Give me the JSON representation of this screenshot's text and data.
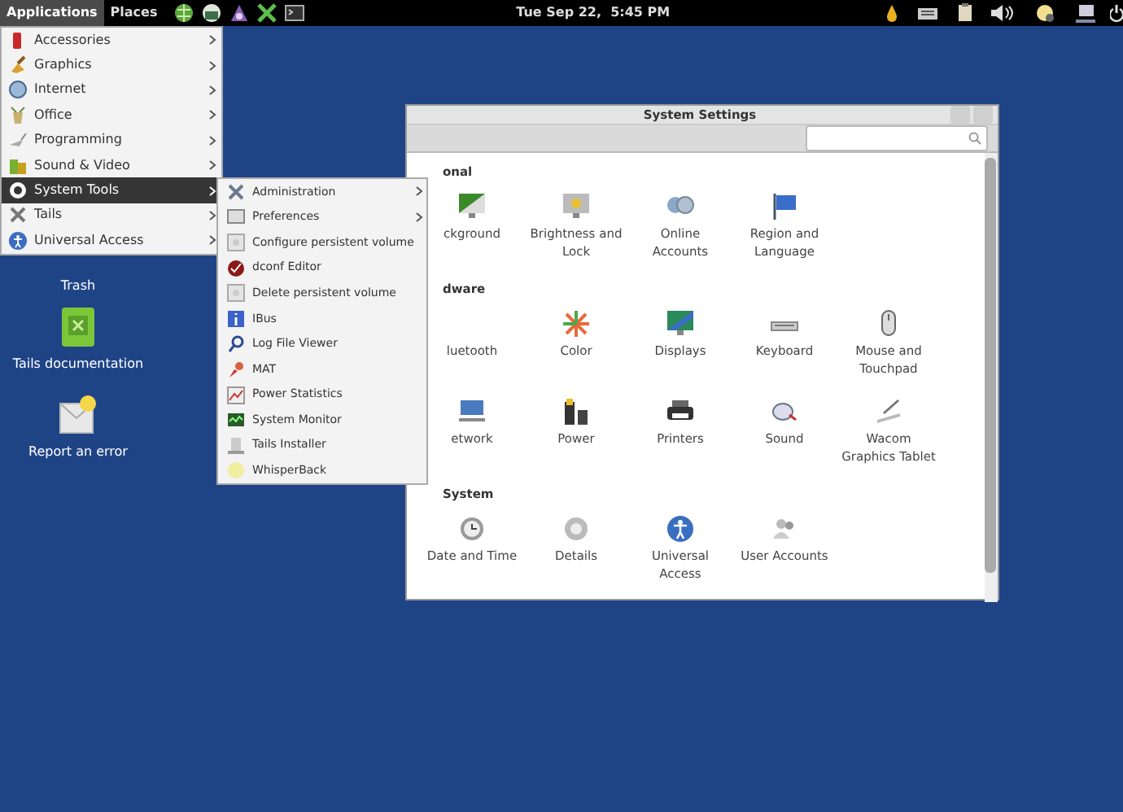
{
  "top_bar": {
    "menus": [
      {
        "label": "Applications",
        "selected": true
      },
      {
        "label": "Places",
        "selected": false
      }
    ],
    "clock": "Tue Sep 22,  5:45 PM"
  },
  "applications_menu": {
    "items": [
      {
        "label": "Accessories",
        "selected": false
      },
      {
        "label": "Graphics",
        "selected": false
      },
      {
        "label": "Internet",
        "selected": false
      },
      {
        "label": "Office",
        "selected": false
      },
      {
        "label": "Programming",
        "selected": false
      },
      {
        "label": "Sound & Video",
        "selected": false
      },
      {
        "label": "System Tools",
        "selected": true
      },
      {
        "label": "Tails",
        "selected": false
      },
      {
        "label": "Universal Access",
        "selected": false
      }
    ]
  },
  "system_tools_menu": {
    "items": [
      {
        "label": "Administration",
        "has_submenu": true
      },
      {
        "label": "Preferences",
        "has_submenu": true
      },
      {
        "label": "Configure persistent volume",
        "has_submenu": false
      },
      {
        "label": "dconf Editor",
        "has_submenu": false
      },
      {
        "label": "Delete persistent volume",
        "has_submenu": false
      },
      {
        "label": "IBus",
        "has_submenu": false
      },
      {
        "label": "Log File Viewer",
        "has_submenu": false
      },
      {
        "label": "MAT",
        "has_submenu": false
      },
      {
        "label": "Power Statistics",
        "has_submenu": false
      },
      {
        "label": "System Monitor",
        "has_submenu": false
      },
      {
        "label": "Tails Installer",
        "has_submenu": false
      },
      {
        "label": "WhisperBack",
        "has_submenu": false
      }
    ]
  },
  "desktop_icons": [
    {
      "label": "Trash"
    },
    {
      "label": "Tails documentation"
    },
    {
      "label": "Report an error"
    }
  ],
  "settings_window": {
    "title": "System Settings",
    "sections": [
      {
        "heading": "onal",
        "items": [
          {
            "label": "ckground"
          },
          {
            "label": "Brightness and Lock"
          },
          {
            "label": "Online Accounts"
          },
          {
            "label": "Region and Language"
          }
        ]
      },
      {
        "heading": "dware",
        "items": [
          {
            "label": "luetooth"
          },
          {
            "label": "Color"
          },
          {
            "label": "Displays"
          },
          {
            "label": "Keyboard"
          },
          {
            "label": "Mouse and Touchpad"
          },
          {
            "label": "etwork"
          },
          {
            "label": "Power"
          },
          {
            "label": "Printers"
          },
          {
            "label": "Sound"
          },
          {
            "label": "Wacom Graphics Tablet"
          }
        ]
      },
      {
        "heading": "System",
        "items": [
          {
            "label": "Date and Time"
          },
          {
            "label": "Details"
          },
          {
            "label": "Universal Access"
          },
          {
            "label": "User Accounts"
          }
        ]
      }
    ]
  }
}
